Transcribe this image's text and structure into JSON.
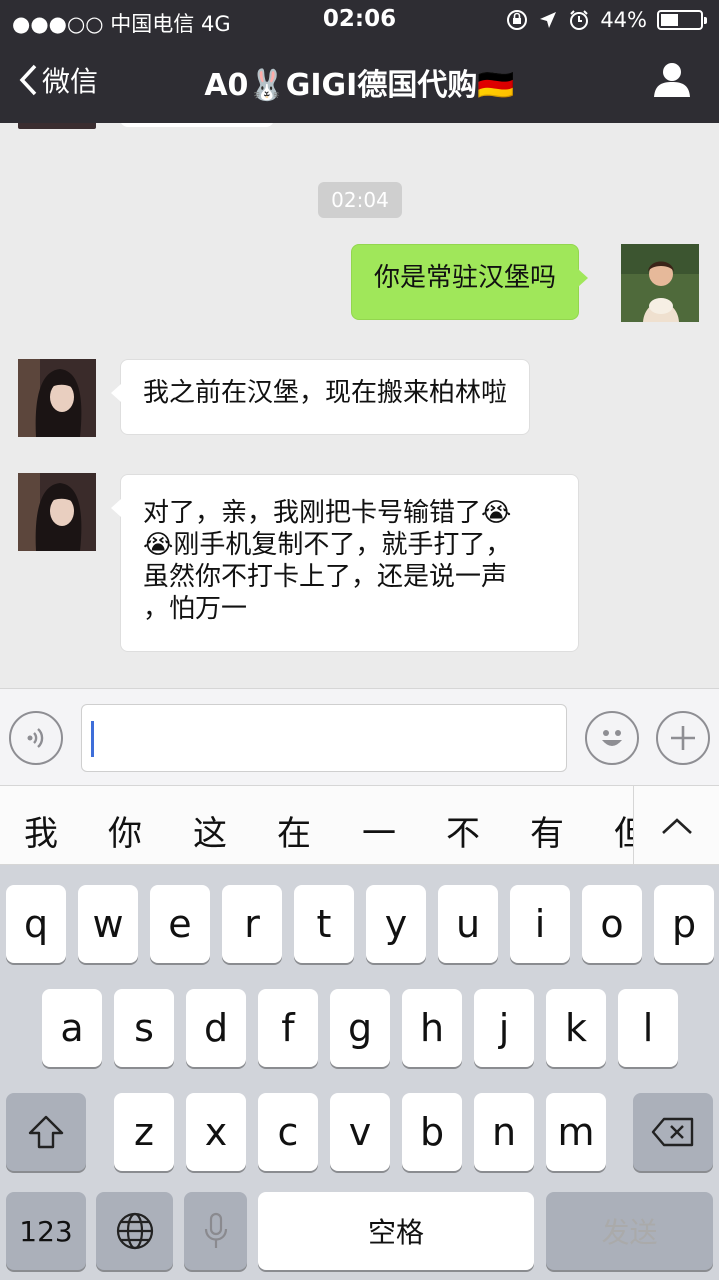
{
  "status_bar": {
    "carrier": "●●●○○ 中国电信  4G",
    "time": "02:06",
    "battery_text": "44%",
    "battery_level": 0.44
  },
  "nav": {
    "back_label": "微信",
    "title": "A0🐰GIGI德国代购🇩🇪"
  },
  "chat": {
    "timestamp": "02:04",
    "messages": [
      {
        "side": "right",
        "text": "你是常驻汉堡吗"
      },
      {
        "side": "left",
        "text": "我之前在汉堡，现在搬来柏林啦"
      },
      {
        "side": "left",
        "lines": [
          "对了，亲，我刚把卡号输错了😭",
          "😭刚手机复制不了，就手打了，",
          "虽然你不打卡上了，还是说一声",
          "，怕万一"
        ]
      }
    ]
  },
  "input": {
    "value": ""
  },
  "candidates": [
    "我",
    "你",
    "这",
    "在",
    "一",
    "不",
    "有",
    "但"
  ],
  "keyboard": {
    "row1": [
      "q",
      "w",
      "e",
      "r",
      "t",
      "y",
      "u",
      "i",
      "o",
      "p"
    ],
    "row2": [
      "a",
      "s",
      "d",
      "f",
      "g",
      "h",
      "j",
      "k",
      "l"
    ],
    "row3": [
      "z",
      "x",
      "c",
      "v",
      "b",
      "n",
      "m"
    ],
    "numbers_label": "123",
    "space_label": "空格",
    "send_label": "发送"
  },
  "icons": {
    "back": "chevron-left-icon",
    "profile": "person-icon",
    "voice": "voice-icon",
    "emoji": "emoji-icon",
    "plus": "plus-icon",
    "expand": "chevron-up-icon",
    "shift": "shift-icon",
    "delete": "backspace-icon",
    "globe": "globe-icon",
    "mic": "microphone-icon"
  },
  "colors": {
    "nav_bg": "#2e2d33",
    "chat_bg": "#ebebeb",
    "bubble_self": "#a0e75a",
    "bubble_other": "#ffffff",
    "caret": "#3e6ed9"
  }
}
